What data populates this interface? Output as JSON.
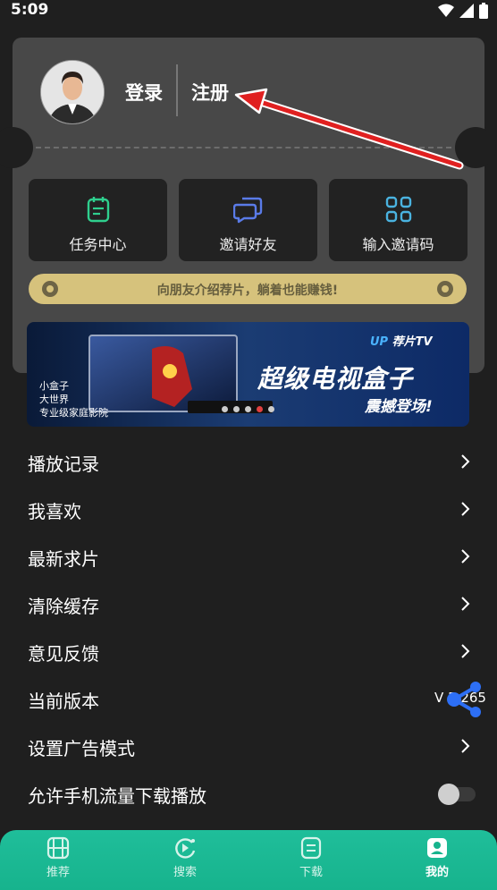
{
  "status_bar": {
    "time": "5:09"
  },
  "profile": {
    "login_label": "登录",
    "register_label": "注册"
  },
  "tiles": [
    {
      "label": "任务中心",
      "icon": "task-list-icon"
    },
    {
      "label": "邀请好友",
      "icon": "chat-bubbles-icon"
    },
    {
      "label": "输入邀请码",
      "icon": "grid-code-icon"
    }
  ],
  "promo": {
    "text": "向朋友介绍荐片，躺着也能赚钱!"
  },
  "tv_banner": {
    "brand": "荐片TV",
    "headline": "超级电视盒子",
    "subline": "震撼登场!",
    "left_text": [
      "小盒子",
      "大世界",
      "专业级家庭影院"
    ],
    "carousel_dots": 5,
    "active_dot": 3
  },
  "menu": {
    "items": [
      {
        "label": "播放记录"
      },
      {
        "label": "我喜欢"
      },
      {
        "label": "最新求片"
      },
      {
        "label": "清除缓存"
      },
      {
        "label": "意见反馈"
      },
      {
        "label": "当前版本",
        "value": "V 5.265"
      },
      {
        "label": "设置广告模式"
      },
      {
        "label": "允许手机流量下载播放"
      }
    ]
  },
  "bottom_nav": {
    "items": [
      {
        "label": "推荐",
        "icon": "film-icon"
      },
      {
        "label": "搜索",
        "icon": "search-play-icon"
      },
      {
        "label": "下载",
        "icon": "download-doc-icon"
      },
      {
        "label": "我的",
        "icon": "profile-icon",
        "active": true
      }
    ]
  },
  "colors": {
    "accent": "#1fbe9a",
    "card": "#484848",
    "background": "#1f1f1f",
    "promo": "#d6c27c",
    "annotation_arrow": "#e02020"
  }
}
